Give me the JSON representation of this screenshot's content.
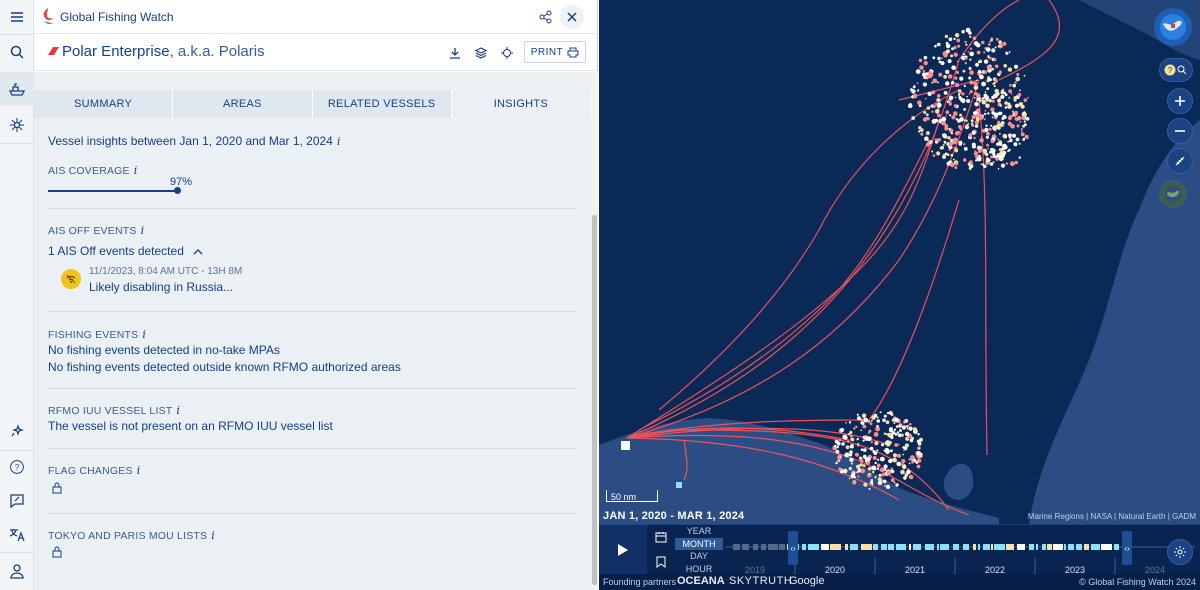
{
  "app": {
    "brand": "Global Fishing Watch"
  },
  "vessel": {
    "name": "Polar Enterprise",
    "aka": ", a.k.a. Polaris",
    "print_label": "PRINT"
  },
  "tabs": [
    {
      "label": "SUMMARY"
    },
    {
      "label": "AREAS"
    },
    {
      "label": "RELATED VESSELS"
    },
    {
      "label": "INSIGHTS",
      "active": true
    }
  ],
  "insights": {
    "intro": "Vessel insights between Jan 1, 2020 and Mar 1, 2024",
    "info_glyph": "i",
    "ais_coverage": {
      "title": "AIS COVERAGE",
      "value_label": "97%",
      "value": 0.97
    },
    "ais_off": {
      "title": "AIS OFF EVENTS",
      "summary": "1 AIS Off events detected",
      "event_time": "11/1/2023, 8:04 AM UTC - 13H 8M",
      "event_desc": "Likely disabling in Russia..."
    },
    "fishing": {
      "title": "FISHING EVENTS",
      "line1": "No fishing events detected in no-take MPAs",
      "line2": "No fishing events detected outside known RFMO authorized areas"
    },
    "rfmo": {
      "title": "RFMO IUU VESSEL LIST",
      "line1": "The vessel is not present on an RFMO IUU vessel list"
    },
    "flag_changes": {
      "title": "FLAG CHANGES"
    },
    "mou": {
      "title": "TOKYO AND PARIS MOU LISTS"
    }
  },
  "map": {
    "scale_label": "50 nm",
    "attribution": "Marine Regions | NASA | Natural Earth | GADM",
    "date_range": "JAN 1, 2020 - MAR 1, 2024",
    "track_color": "#f2555c",
    "land_color": "#2b4d84",
    "ocean_color": "#0b2957"
  },
  "timebar": {
    "resolutions": [
      {
        "label": "YEAR"
      },
      {
        "label": "MONTH",
        "active": true
      },
      {
        "label": "DAY"
      },
      {
        "label": "HOUR"
      }
    ],
    "years": [
      {
        "label": "2019",
        "faded": true
      },
      {
        "label": "2020"
      },
      {
        "label": "2021"
      },
      {
        "label": "2022"
      },
      {
        "label": "2023"
      },
      {
        "label": "2024",
        "faded": true
      }
    ]
  },
  "footer": {
    "partners_label": "Founding partners",
    "partners": [
      "OCEANA",
      "SKYTRUTH",
      "Google"
    ],
    "copyright": "© Global Fishing Watch 2024"
  }
}
